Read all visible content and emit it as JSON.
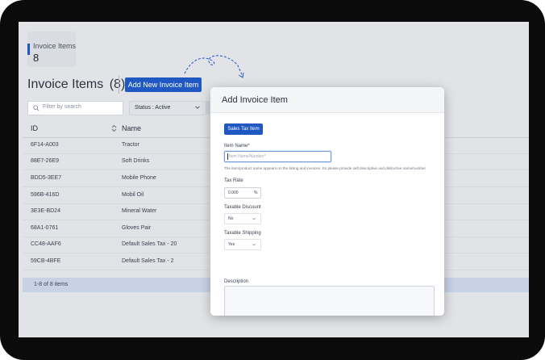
{
  "stat_card": {
    "label": "Invoice Items",
    "count": "8"
  },
  "page": {
    "title": "Invoice Items",
    "count": "(8)"
  },
  "toolbar": {
    "add_label": "Add New Invoice Item"
  },
  "filters": {
    "search_placeholder": "Filter by search",
    "status_label": "Status : Active"
  },
  "table": {
    "columns": [
      "ID",
      "Name"
    ],
    "rows": [
      {
        "id": "6F14-A003",
        "name": "Tractor"
      },
      {
        "id": "88E7-26E9",
        "name": "Soft Drinks"
      },
      {
        "id": "BDD5-3EE7",
        "name": "Mobile Phone"
      },
      {
        "id": "596B-416D",
        "name": "Mobil Oil"
      },
      {
        "id": "3E3E-BD24",
        "name": "Mineral Water"
      },
      {
        "id": "68A1-0761",
        "name": "Gloves Pair"
      },
      {
        "id": "CC48-AAF6",
        "name": "Default Sales Tax - 20"
      },
      {
        "id": "59CB-4BFE",
        "name": "Default Sales Tax - 2"
      }
    ],
    "footer": "1-8 of 8 items"
  },
  "modal": {
    "title": "Add Invoice Item",
    "tab_label": "Sales Tax Item",
    "item_name_label": "Item Name*",
    "item_name_placeholder": "Item Name/Number*",
    "item_name_help": "The item/product name appears on the listing and invoices. So please provide self descriptive and distinctive name/number",
    "tax_rate_label": "Tax Rate",
    "tax_rate_value": "0.000",
    "tax_rate_unit": "%",
    "taxable_discount_label": "Taxable Discount",
    "taxable_discount_value": "No",
    "taxable_shipping_label": "Taxable Shipping",
    "taxable_shipping_value": "Yes",
    "description_label": "Description"
  },
  "icons": {
    "search": "search-icon",
    "status": "chevron-down-icon",
    "sort": "sort-icon",
    "arrow": "curved-arrow-icon"
  },
  "colors": {
    "accent": "#1f57c3",
    "frame": "#0b0b0b",
    "footer": "#c7d3e5"
  }
}
